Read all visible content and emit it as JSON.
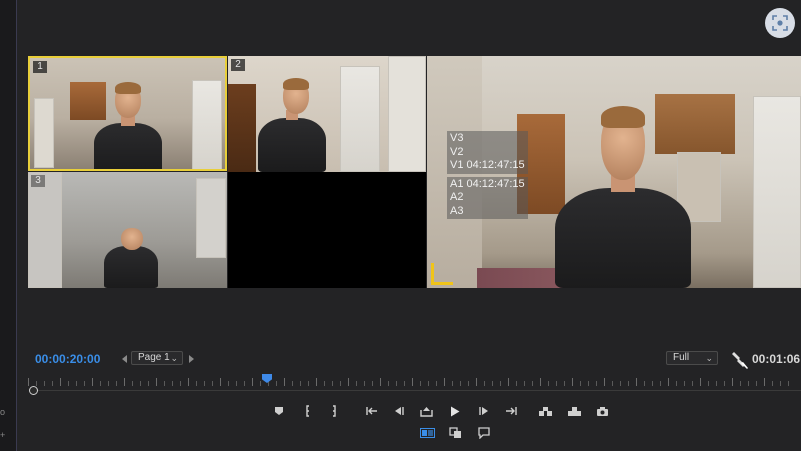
{
  "monitor": {
    "cameras": [
      {
        "id": "1",
        "label": "1",
        "selected": true
      },
      {
        "id": "2",
        "label": "2",
        "selected": false
      },
      {
        "id": "3",
        "label": "3",
        "selected": false
      },
      {
        "id": "4",
        "label": "",
        "selected": false
      }
    ],
    "overlay_lines_group1": [
      "V3",
      "V2",
      "V1 04:12:47:15"
    ],
    "overlay_lines_group2": [
      "A1 04:12:47:15",
      "A2",
      "A3"
    ]
  },
  "transport": {
    "current_timecode": "00:00:20:00",
    "duration_timecode": "00:01:06",
    "page_select": "Page 1",
    "resolution_select": "Full"
  },
  "icons": {
    "top_right": "screen-capture-icon",
    "settings": "wrench-icon",
    "buttons": [
      "add-marker-icon",
      "mark-in-icon",
      "mark-out-icon",
      "go-to-in-icon",
      "step-back-icon",
      "lift-icon",
      "play-icon",
      "step-forward-icon",
      "go-to-out-icon",
      "insert-icon",
      "overwrite-icon",
      "export-frame-icon",
      "multicam-toggle-icon",
      "comparison-view-icon",
      "comment-icon"
    ]
  },
  "colors": {
    "accent_blue": "#3a8ee8",
    "selection_yellow": "#f0c419"
  }
}
